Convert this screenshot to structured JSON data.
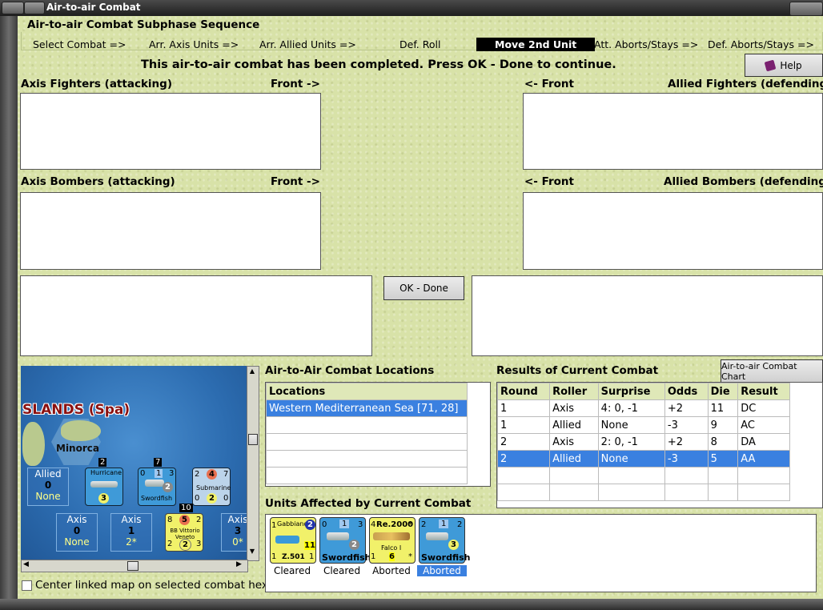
{
  "window": {
    "title": "Air-to-air Combat"
  },
  "phase": {
    "title": "Air-to-air Combat Subphase Sequence",
    "steps": [
      "Select Combat =>",
      "Arr. Axis Units =>",
      "Arr. Allied Units =>",
      "Def. Roll",
      "Move 2nd Unit",
      "Att. Aborts/Stays =>",
      "Def. Aborts/Stays =>"
    ],
    "active_step": "Move 2nd Unit"
  },
  "status_message": "This air-to-air combat has been completed.  Press OK - Done to continue.",
  "help_label": "Help",
  "labels": {
    "axis_fighters": "Axis Fighters (attacking)",
    "axis_bombers": "Axis Bombers (attacking)",
    "allied_fighters": "Allied Fighters (defending)",
    "allied_bombers": "Allied Bombers (defending)",
    "front_right": "Front ->",
    "front_left": "<- Front"
  },
  "ok_done_label": "OK - Done",
  "locations": {
    "title": "Air-to-Air Combat Locations",
    "header": "Locations",
    "items": [
      "Western Mediterranean Sea [71, 28]"
    ]
  },
  "results": {
    "title": "Results of Current Combat",
    "chart_button": "Air-to-air Combat Chart",
    "columns": [
      "Round",
      "Roller",
      "Surprise",
      "Odds",
      "Die",
      "Result"
    ],
    "rows": [
      [
        "1",
        "Axis",
        "4: 0, -1",
        "+2",
        "11",
        "DC"
      ],
      [
        "1",
        "Allied",
        "None",
        "-3",
        "9",
        "AC"
      ],
      [
        "2",
        "Axis",
        "2: 0, -1",
        "+2",
        "8",
        "DA"
      ],
      [
        "2",
        "Allied",
        "None",
        "-3",
        "5",
        "AA"
      ]
    ],
    "selected_row": 3
  },
  "units_affected": {
    "title": "Units Affected by Current Combat",
    "units": [
      {
        "name": "Z.501",
        "top": "Gabbiano",
        "left": "1",
        "right": "2",
        "bl": "1",
        "br": "1",
        "mid": "11",
        "status": "Cleared",
        "color": "#f1f16a"
      },
      {
        "name": "Swordfish",
        "top": "",
        "left": "0",
        "right": "3",
        "bl": "",
        "br": "",
        "mid": "2",
        "top_mid": "1",
        "status": "Cleared",
        "color": "#3f9ad8"
      },
      {
        "name": "Falco I",
        "top": "Re.2000",
        "left": "4",
        "right": "*",
        "bl": "1",
        "br": "*",
        "mid": "6",
        "status": "Aborted",
        "color": "#f1f16a"
      },
      {
        "name": "Swordfish",
        "top": "",
        "left": "2",
        "right": "2",
        "bl": "",
        "br": "",
        "mid": "3",
        "top_mid": "1",
        "status": "Aborted",
        "color": "#3f9ad8"
      }
    ],
    "selected_index": 3
  },
  "map": {
    "region_label": "SLANDS (Spa)",
    "island_label": "Minorca",
    "allied_box": {
      "side": "Allied",
      "value": "0",
      "note": "None"
    },
    "axis_boxes": [
      {
        "side": "Axis",
        "value": "0",
        "note": "None"
      },
      {
        "side": "Axis",
        "value": "1",
        "note": "2*"
      },
      {
        "side": "Axis",
        "value": "3",
        "note": "0*"
      }
    ],
    "counters": [
      {
        "name": "Hurricane",
        "stack": "2",
        "mid": "3"
      },
      {
        "name": "Swordfish",
        "stack": "7",
        "tl": "0",
        "tm": "1",
        "tr": "3",
        "mid": "2"
      },
      {
        "name": "Submarine",
        "tl": "2",
        "tm": "4",
        "tr": "7",
        "bl": "0",
        "bm": "2",
        "br": "0"
      },
      {
        "name": "BB Vittorio Veneto",
        "stack": "10",
        "tl": "8",
        "tm": "5",
        "tr": "2",
        "bl": "2",
        "bm": "2",
        "br": "3"
      }
    ]
  },
  "center_map_label": "Center linked map on selected combat hex",
  "colors": {
    "background": "#d8e2a8",
    "selection": "#3a80e0",
    "active_step_bg": "#000000"
  }
}
